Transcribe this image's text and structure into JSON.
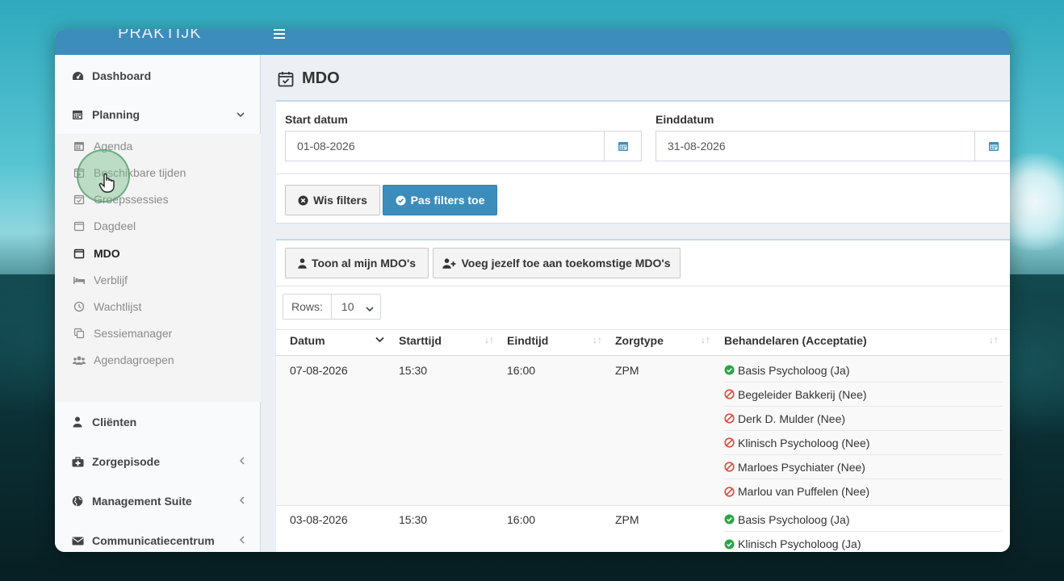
{
  "app": {
    "brand": "PRAKTIJK",
    "colors": {
      "primary": "#3c8dbc",
      "success": "#28a745",
      "danger": "#dd4b39"
    }
  },
  "sidebar": {
    "items": [
      {
        "label": "Dashboard",
        "icon": "dashboard-icon"
      },
      {
        "label": "Planning",
        "icon": "calendar-icon",
        "expanded": true
      },
      {
        "label": "Cliënten",
        "icon": "user-icon"
      },
      {
        "label": "Zorgepisode",
        "icon": "medkit-icon"
      },
      {
        "label": "Management Suite",
        "icon": "globe-icon"
      },
      {
        "label": "Communicatiecentrum",
        "icon": "envelope-icon"
      }
    ],
    "planning_sub": [
      {
        "label": "Agenda",
        "icon": "calendar-grid-icon"
      },
      {
        "label": "Beschikbare tijden",
        "icon": "calendar-plus-icon"
      },
      {
        "label": "Groepssessies",
        "icon": "calendar-check-icon"
      },
      {
        "label": "Dagdeel",
        "icon": "calendar-empty-icon"
      },
      {
        "label": "MDO",
        "icon": "calendar-empty-icon",
        "active": true
      },
      {
        "label": "Verblijf",
        "icon": "bed-icon"
      },
      {
        "label": "Wachtlijst",
        "icon": "clock-icon"
      },
      {
        "label": "Sessiemanager",
        "icon": "copy-icon"
      },
      {
        "label": "Agendagroepen",
        "icon": "users-icon"
      }
    ]
  },
  "page": {
    "title": "MDO"
  },
  "filters": {
    "start_label": "Start datum",
    "start_value": "01-08-2026",
    "end_label": "Einddatum",
    "end_value": "31-08-2026",
    "clear_label": "Wis filters",
    "apply_label": "Pas filters toe"
  },
  "actions": {
    "show_mine": "Toon al mijn MDO's",
    "join_future": "Voeg jezelf toe aan toekomstige MDO's"
  },
  "table": {
    "rows_label": "Rows:",
    "rows_value": "10",
    "columns": [
      "Datum",
      "Starttijd",
      "Eindtijd",
      "Zorgtype",
      "Behandelaren (Acceptatie)"
    ],
    "rows": [
      {
        "datum": "07-08-2026",
        "start": "15:30",
        "eind": "16:00",
        "zorgtype": "ZPM",
        "behandelaren": [
          {
            "name": "Basis Psycholoog (Ja)",
            "accepted": true
          },
          {
            "name": "Begeleider Bakkerij (Nee)",
            "accepted": false
          },
          {
            "name": "Derk D. Mulder (Nee)",
            "accepted": false
          },
          {
            "name": "Klinisch Psycholoog (Nee)",
            "accepted": false
          },
          {
            "name": "Marloes Psychiater (Nee)",
            "accepted": false
          },
          {
            "name": "Marlou van Puffelen (Nee)",
            "accepted": false
          }
        ]
      },
      {
        "datum": "03-08-2026",
        "start": "15:30",
        "eind": "16:00",
        "zorgtype": "ZPM",
        "behandelaren": [
          {
            "name": "Basis Psycholoog (Ja)",
            "accepted": true
          },
          {
            "name": "Klinisch Psycholoog (Ja)",
            "accepted": true
          }
        ]
      }
    ]
  }
}
